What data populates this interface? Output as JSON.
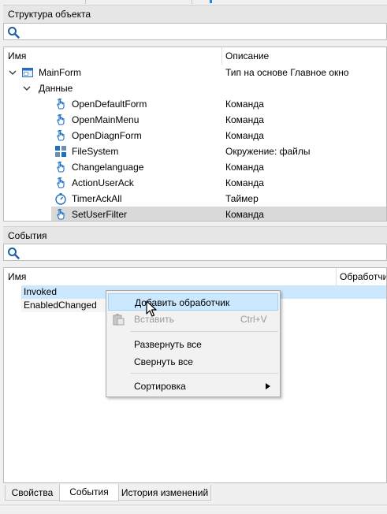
{
  "structure_panel": {
    "title": "Структура объекта",
    "col_name": "Имя",
    "col_desc": "Описание",
    "tree": [
      {
        "name": "MainForm",
        "desc": "Тип на основе Главное окно",
        "icon": "form-icon",
        "level": 0,
        "expanded": true
      },
      {
        "name": "Данные",
        "desc": "",
        "icon": "",
        "level": 1,
        "expanded": true
      },
      {
        "name": "OpenDefaultForm",
        "desc": "Команда",
        "icon": "command-hand-icon",
        "level": 2
      },
      {
        "name": "OpenMainMenu",
        "desc": "Команда",
        "icon": "command-hand-icon",
        "level": 2
      },
      {
        "name": "OpenDiagnForm",
        "desc": "Команда",
        "icon": "command-hand-icon",
        "level": 2
      },
      {
        "name": "FileSystem",
        "desc": "Окружение: файлы",
        "icon": "filesystem-icon",
        "level": 2
      },
      {
        "name": "Changelanguage",
        "desc": "Команда",
        "icon": "command-hand-icon",
        "level": 2
      },
      {
        "name": "ActionUserAck",
        "desc": "Команда",
        "icon": "command-hand-icon",
        "level": 2
      },
      {
        "name": "TimerAckAll",
        "desc": "Таймер",
        "icon": "timer-icon",
        "level": 2
      },
      {
        "name": "SetUserFilter",
        "desc": "Команда",
        "icon": "command-hand-icon",
        "level": 2,
        "selected": true
      }
    ]
  },
  "events_panel": {
    "title": "События",
    "col_name": "Имя",
    "col_handler": "Обработчи",
    "events": [
      "Invoked",
      "EnabledChanged"
    ]
  },
  "context_menu": {
    "items": [
      {
        "label": "Добавить обработчик",
        "shortcut": "",
        "state": "highlighted"
      },
      {
        "label": "Вставить",
        "shortcut": "Ctrl+V",
        "state": "disabled",
        "icon": "paste-icon"
      },
      {
        "label": "Развернуть все",
        "shortcut": "",
        "state": "normal"
      },
      {
        "label": "Свернуть все",
        "shortcut": "",
        "state": "normal"
      },
      {
        "label": "Сортировка",
        "shortcut": "",
        "state": "normal",
        "submenu": true
      }
    ]
  },
  "tabs": {
    "items": [
      "Свойства",
      "События",
      "История изменений"
    ],
    "active": "События"
  },
  "colors": {
    "accent": "#1e88e5",
    "selection": "#d9d9d9",
    "menu_highlight": "#cce8ff",
    "event_row": "#cce8ff"
  }
}
